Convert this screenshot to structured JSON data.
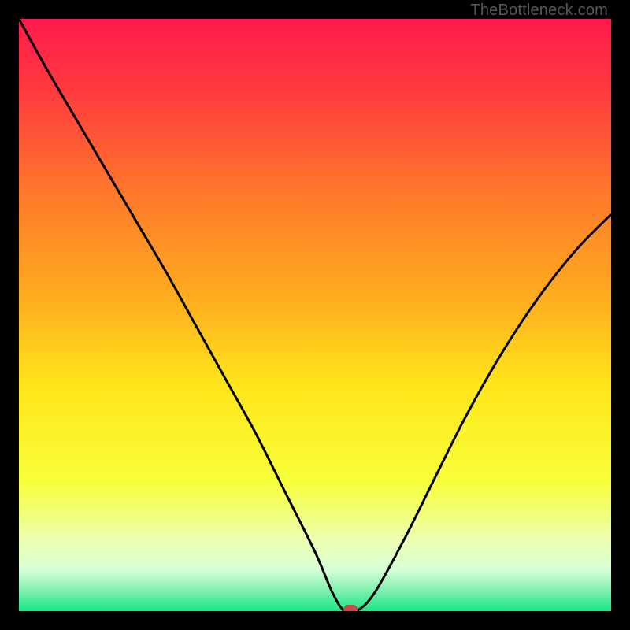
{
  "watermark": "TheBottleneck.com",
  "chart_data": {
    "type": "line",
    "title": "",
    "xlabel": "",
    "ylabel": "",
    "xlim": [
      0,
      100
    ],
    "ylim": [
      0,
      100
    ],
    "series": [
      {
        "name": "bottleneck-curve",
        "x": [
          0,
          5,
          10,
          15,
          20,
          25,
          30,
          35,
          40,
          45,
          50,
          53,
          55,
          57,
          60,
          65,
          70,
          75,
          80,
          85,
          90,
          95,
          100
        ],
        "y": [
          100,
          91,
          82.5,
          74,
          65.5,
          57,
          48,
          39,
          30,
          20,
          10,
          3,
          0,
          0,
          3,
          12,
          22,
          32,
          41,
          49,
          56,
          62,
          67
        ]
      }
    ],
    "marker": {
      "x": 56,
      "y": 0,
      "color": "#c94a46"
    },
    "gradient_stops": [
      {
        "offset": 0.0,
        "color": "#ff1a4b"
      },
      {
        "offset": 0.12,
        "color": "#ff3a3f"
      },
      {
        "offset": 0.3,
        "color": "#ff7a2a"
      },
      {
        "offset": 0.48,
        "color": "#ffb01f"
      },
      {
        "offset": 0.62,
        "color": "#ffe61a"
      },
      {
        "offset": 0.78,
        "color": "#f8ff3a"
      },
      {
        "offset": 0.88,
        "color": "#ecffb0"
      },
      {
        "offset": 0.93,
        "color": "#d7ffd7"
      },
      {
        "offset": 0.965,
        "color": "#7ff0b0"
      },
      {
        "offset": 1.0,
        "color": "#17e884"
      }
    ]
  }
}
